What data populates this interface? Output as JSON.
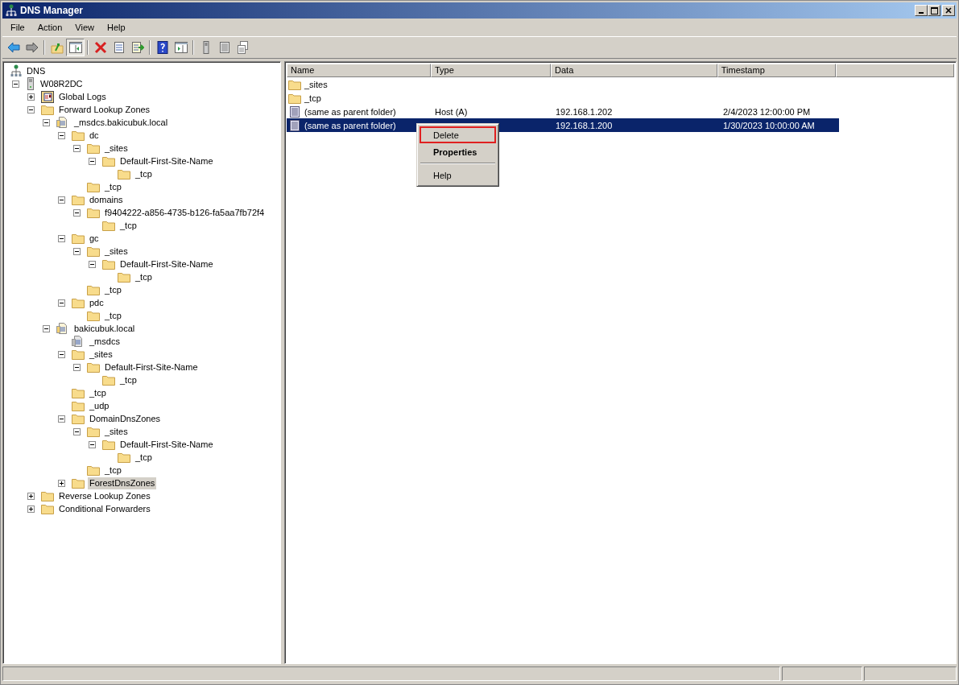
{
  "window": {
    "title": "DNS Manager"
  },
  "menu_bar": [
    "File",
    "Action",
    "View",
    "Help"
  ],
  "toolbar": [
    {
      "pressed": false
    },
    {
      "pressed": false
    },
    {
      "pressed": false
    },
    {
      "pressed": true
    },
    {
      "pressed": false
    },
    {
      "pressed": false
    },
    {
      "pressed": false
    },
    {
      "pressed": false
    },
    {
      "pressed": false
    },
    {
      "pressed": false
    },
    {
      "pressed": false
    },
    {
      "pressed": false
    }
  ],
  "tree": [
    {
      "label": "DNS",
      "kind": "dns",
      "selected": false,
      "children": [
        {
          "label": "W08R2DC",
          "kind": "server",
          "expanded": true,
          "selected": false,
          "children": [
            {
              "label": "Global Logs",
              "kind": "logs",
              "expanded": false,
              "selected": false
            },
            {
              "label": "Forward Lookup Zones",
              "kind": "folder",
              "expanded": true,
              "selected": false,
              "children": [
                {
                  "label": "_msdcs.bakicubuk.local",
                  "kind": "zone",
                  "expanded": true,
                  "selected": false,
                  "children": [
                    {
                      "label": "dc",
                      "kind": "folder",
                      "expanded": true,
                      "selected": false,
                      "children": [
                        {
                          "label": "_sites",
                          "kind": "folder",
                          "expanded": true,
                          "selected": false,
                          "children": [
                            {
                              "label": "Default-First-Site-Name",
                              "kind": "folder",
                              "expanded": true,
                              "selected": false,
                              "children": [
                                {
                                  "label": "_tcp",
                                  "kind": "folder",
                                  "selected": false
                                }
                              ]
                            }
                          ]
                        },
                        {
                          "label": "_tcp",
                          "kind": "folder",
                          "selected": false
                        }
                      ]
                    },
                    {
                      "label": "domains",
                      "kind": "folder",
                      "expanded": true,
                      "selected": false,
                      "children": [
                        {
                          "label": "f9404222-a856-4735-b126-fa5aa7fb72f4",
                          "kind": "folder",
                          "expanded": true,
                          "selected": false,
                          "children": [
                            {
                              "label": "_tcp",
                              "kind": "folder",
                              "selected": false
                            }
                          ]
                        }
                      ]
                    },
                    {
                      "label": "gc",
                      "kind": "folder",
                      "expanded": true,
                      "selected": false,
                      "children": [
                        {
                          "label": "_sites",
                          "kind": "folder",
                          "expanded": true,
                          "selected": false,
                          "children": [
                            {
                              "label": "Default-First-Site-Name",
                              "kind": "folder",
                              "expanded": true,
                              "selected": false,
                              "children": [
                                {
                                  "label": "_tcp",
                                  "kind": "folder",
                                  "selected": false
                                }
                              ]
                            }
                          ]
                        },
                        {
                          "label": "_tcp",
                          "kind": "folder",
                          "selected": false
                        }
                      ]
                    },
                    {
                      "label": "pdc",
                      "kind": "folder",
                      "expanded": true,
                      "selected": false,
                      "children": [
                        {
                          "label": "_tcp",
                          "kind": "folder",
                          "selected": false
                        }
                      ]
                    }
                  ]
                },
                {
                  "label": "bakicubuk.local",
                  "kind": "zone",
                  "expanded": true,
                  "selected": false,
                  "children": [
                    {
                      "label": "_msdcs",
                      "kind": "delegation",
                      "selected": false
                    },
                    {
                      "label": "_sites",
                      "kind": "folder",
                      "expanded": true,
                      "selected": false,
                      "children": [
                        {
                          "label": "Default-First-Site-Name",
                          "kind": "folder",
                          "expanded": true,
                          "selected": false,
                          "children": [
                            {
                              "label": "_tcp",
                              "kind": "folder",
                              "selected": false
                            }
                          ]
                        }
                      ]
                    },
                    {
                      "label": "_tcp",
                      "kind": "folder",
                      "selected": false
                    },
                    {
                      "label": "_udp",
                      "kind": "folder",
                      "selected": false
                    },
                    {
                      "label": "DomainDnsZones",
                      "kind": "folder",
                      "expanded": true,
                      "selected": false,
                      "children": [
                        {
                          "label": "_sites",
                          "kind": "folder",
                          "expanded": true,
                          "selected": false,
                          "children": [
                            {
                              "label": "Default-First-Site-Name",
                              "kind": "folder",
                              "expanded": true,
                              "selected": false,
                              "children": [
                                {
                                  "label": "_tcp",
                                  "kind": "folder",
                                  "selected": false
                                }
                              ]
                            }
                          ]
                        },
                        {
                          "label": "_tcp",
                          "kind": "folder",
                          "selected": false
                        }
                      ]
                    },
                    {
                      "label": "ForestDnsZones",
                      "kind": "folder",
                      "expanded": false,
                      "selected": true
                    }
                  ]
                }
              ]
            },
            {
              "label": "Reverse Lookup Zones",
              "kind": "folder",
              "expanded": false,
              "selected": false
            },
            {
              "label": "Conditional Forwarders",
              "kind": "folder",
              "expanded": false,
              "selected": false
            }
          ]
        }
      ]
    }
  ],
  "list": {
    "columns": [
      "Name",
      "Type",
      "Data",
      "Timestamp"
    ],
    "rows": [
      {
        "kind": "folder",
        "name": "_sites",
        "selected": false
      },
      {
        "kind": "folder",
        "name": "_tcp",
        "selected": false
      },
      {
        "kind": "record",
        "name": "(same as parent folder)",
        "type": "Host (A)",
        "data": "192.168.1.202",
        "timestamp": "2/4/2023 12:00:00 PM",
        "selected": false
      },
      {
        "kind": "record",
        "name": "(same as parent folder)",
        "data": "192.168.1.200",
        "timestamp": "1/30/2023 10:00:00 AM",
        "selected": true
      }
    ]
  },
  "context_menu": [
    {
      "kind": "item",
      "label": "Delete",
      "highlighted": true,
      "bold": false
    },
    {
      "kind": "item",
      "label": "Properties",
      "highlighted": false,
      "bold": true
    },
    {
      "kind": "separator"
    },
    {
      "kind": "item",
      "label": "Help",
      "highlighted": false,
      "bold": false
    }
  ]
}
